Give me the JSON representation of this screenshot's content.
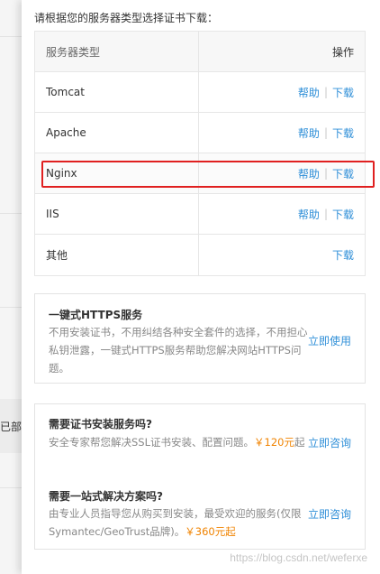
{
  "left_peek": {
    "text": "已部署"
  },
  "intro": "请根据您的服务器类型选择证书下载：",
  "table": {
    "header": {
      "type": "服务器类型",
      "ops": "操作"
    },
    "rows": [
      {
        "type": "Tomcat",
        "help": "帮助",
        "download": "下载"
      },
      {
        "type": "Apache",
        "help": "帮助",
        "download": "下载"
      },
      {
        "type": "Nginx",
        "help": "帮助",
        "download": "下载"
      },
      {
        "type": "IIS",
        "help": "帮助",
        "download": "下载"
      },
      {
        "type": "其他",
        "download": "下载"
      }
    ],
    "separator": "|"
  },
  "https_card": {
    "title": "一键式HTTPS服务",
    "desc": "不用安装证书，不用纠结各种安全套件的选择，不用担心私钥泄露，一键式HTTPS服务帮助您解决网站HTTPS问题。",
    "action": "立即使用"
  },
  "install_card": {
    "q1_title": "需要证书安装服务吗?",
    "q1_desc": "安全专家帮您解决SSL证书安装、配置问题。",
    "q1_price": "￥120元",
    "q1_desc_tail": "起",
    "q1_action": "立即咨询",
    "q2_title": "需要一站式解决方案吗?",
    "q2_desc": "由专业人员指导您从购买到安装，最受欢迎的服务(仅限Symantec/GeoTrust品牌)。",
    "q2_price": "￥360元起",
    "q2_action": "立即咨询"
  },
  "watermark": "https://blog.csdn.net/weferxe",
  "colors": {
    "link": "#2f8fd8",
    "price": "#f08300",
    "highlight": "#e02020"
  }
}
